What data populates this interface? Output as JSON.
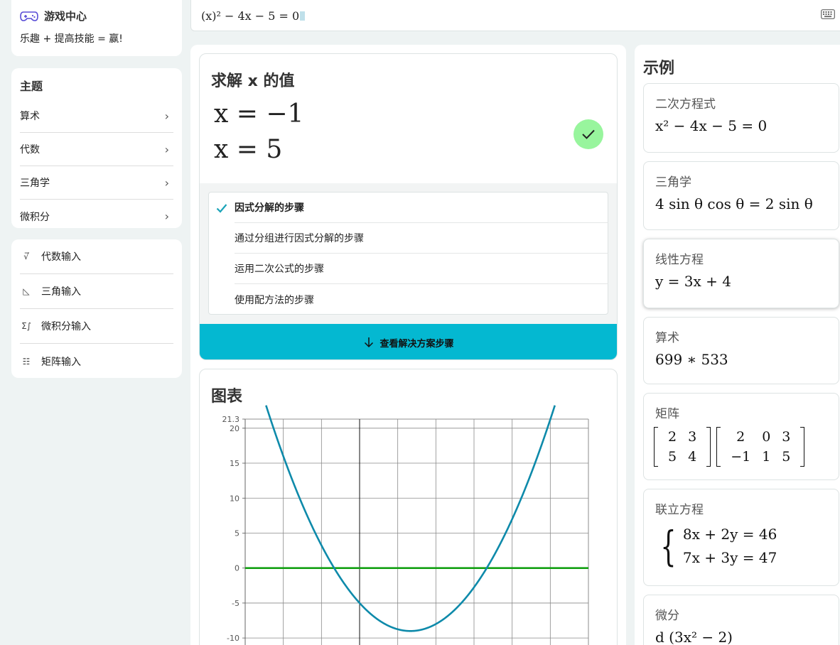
{
  "sidebar": {
    "game": {
      "title": "游戏中心",
      "subtitle": "乐趣 + 提高技能 = 赢!"
    },
    "topics": {
      "heading": "主题",
      "items": [
        {
          "label": "算术"
        },
        {
          "label": "代数"
        },
        {
          "label": "三角学"
        },
        {
          "label": "微积分"
        }
      ]
    },
    "inputs": [
      {
        "label": "代数输入",
        "icon_glyph": "√̅"
      },
      {
        "label": "三角输入",
        "icon_glyph": "◺"
      },
      {
        "label": "微积分输入",
        "icon_glyph": "Σ∫"
      },
      {
        "label": "矩阵输入",
        "icon_glyph": "☷"
      }
    ]
  },
  "input_bar": {
    "expression": "(x)² − 4x − 5 = 0"
  },
  "solution": {
    "heading": "求解 x 的值",
    "answers": [
      "x = −1",
      "x = 5"
    ],
    "steps": [
      {
        "label": "因式分解的步骤",
        "selected": true
      },
      {
        "label": "通过分组进行因式分解的步骤",
        "selected": false
      },
      {
        "label": "运用二次公式的步骤",
        "selected": false
      },
      {
        "label": "使用配方法的步骤",
        "selected": false
      }
    ],
    "view_steps_label": "查看解决方案步骤"
  },
  "graph": {
    "heading": "图表"
  },
  "chart_data": {
    "type": "line",
    "title": "",
    "xlabel": "",
    "ylabel": "",
    "xlim": [
      -4.5,
      9
    ],
    "ylim": [
      -11,
      21.3
    ],
    "y_ticks": [
      21.3,
      20,
      15,
      10,
      5,
      0,
      -5,
      -10
    ],
    "y_tick_labels": [
      "21.3",
      "20",
      "15",
      "10",
      "5",
      "0",
      "-5",
      "-10"
    ],
    "grid": true,
    "series": [
      {
        "function": "x^2 - 4x - 5",
        "color": "#0e8aaa",
        "vertex": [
          2,
          -9
        ]
      },
      {
        "function": "0",
        "color": "#13a013"
      }
    ]
  },
  "examples": {
    "heading": "示例",
    "items": [
      {
        "label": "二次方程式",
        "math": "x² − 4x − 5 = 0"
      },
      {
        "label": "三角学",
        "math": "4 sin θ cos θ = 2 sin θ"
      },
      {
        "label": "线性方程",
        "math": "y = 3x + 4"
      },
      {
        "label": "算术",
        "math": "699 ∗ 533"
      },
      {
        "label": "矩阵",
        "matrix_a": [
          [
            "2",
            "3"
          ],
          [
            "5",
            "4"
          ]
        ],
        "matrix_b": [
          [
            "2",
            "0",
            "3"
          ],
          [
            "−1",
            "1",
            "5"
          ]
        ]
      },
      {
        "label": "联立方程",
        "equations": [
          "8x + 2y = 46",
          "7x + 3y = 47"
        ]
      },
      {
        "label": "微分",
        "math": "d  (3x² − 2)"
      }
    ]
  },
  "colors": {
    "accent_button": "#04b8d1",
    "check_badge": "#98f59d",
    "curve": "#0e8aaa",
    "zero_line": "#13a013",
    "step_check": "#1aa3b8"
  }
}
